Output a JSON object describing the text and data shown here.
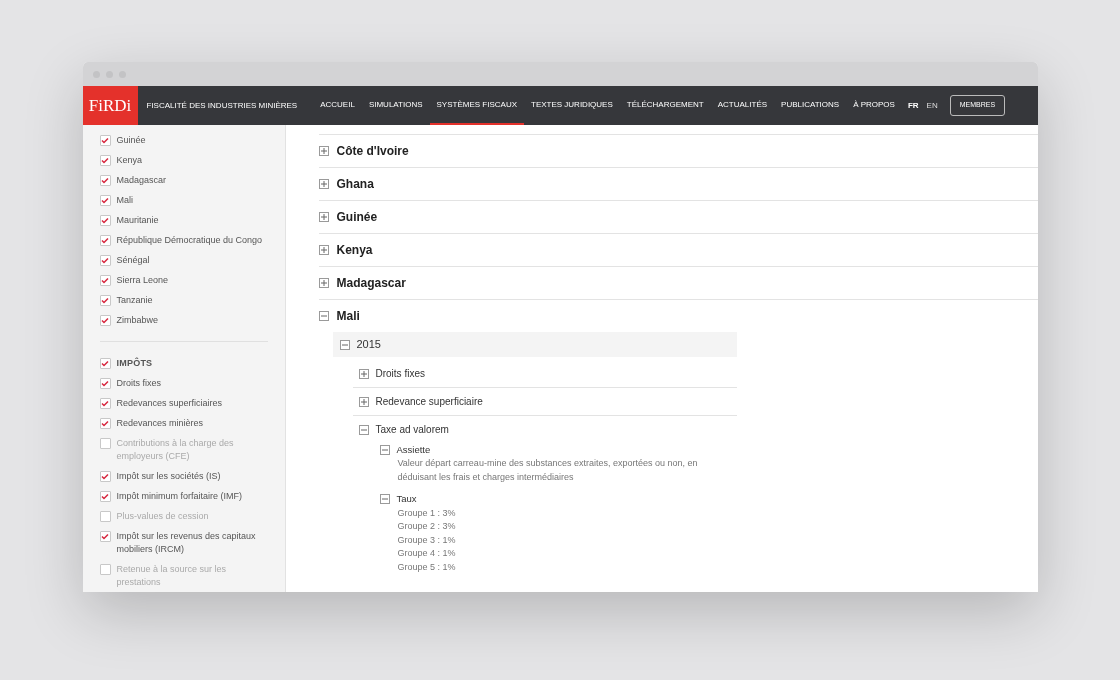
{
  "header": {
    "logo": "FiRDi",
    "site_title": "FISCALITÉ DES INDUSTRIES MINIÈRES",
    "nav": [
      {
        "label": "ACCUEIL",
        "selected": false
      },
      {
        "label": "SIMULATIONS",
        "selected": false
      },
      {
        "label": "SYSTÈMES FISCAUX",
        "selected": true
      },
      {
        "label": "TEXTES JURIDIQUES",
        "selected": false
      },
      {
        "label": "TÉLÉCHARGEMENT",
        "selected": false
      },
      {
        "label": "ACTUALITÉS",
        "selected": false
      },
      {
        "label": "PUBLICATIONS",
        "selected": false
      },
      {
        "label": "À PROPOS",
        "selected": false
      }
    ],
    "languages": [
      {
        "label": "FR",
        "selected": true
      },
      {
        "label": "EN",
        "selected": false
      }
    ],
    "members_button": "MEMBRES"
  },
  "sidebar": {
    "countries": [
      {
        "label": "Guinée",
        "checked": true
      },
      {
        "label": "Kenya",
        "checked": true
      },
      {
        "label": "Madagascar",
        "checked": true
      },
      {
        "label": "Mali",
        "checked": true
      },
      {
        "label": "Mauritanie",
        "checked": true
      },
      {
        "label": "République Démocratique du Congo",
        "checked": true
      },
      {
        "label": "Sénégal",
        "checked": true
      },
      {
        "label": "Sierra Leone",
        "checked": true
      },
      {
        "label": "Tanzanie",
        "checked": true
      },
      {
        "label": "Zimbabwe",
        "checked": true
      }
    ],
    "tax_group": {
      "label": "IMPÔTS",
      "checked": true
    },
    "taxes": [
      {
        "label": "Droits fixes",
        "checked": true
      },
      {
        "label": "Redevances superficiaires",
        "checked": true
      },
      {
        "label": "Redevances minières",
        "checked": true
      },
      {
        "label": "Contributions à la charge des employeurs (CFE)",
        "checked": false
      },
      {
        "label": "Impôt sur les sociétés (IS)",
        "checked": true
      },
      {
        "label": "Impôt minimum forfaitaire (IMF)",
        "checked": true
      },
      {
        "label": "Plus-values de cession",
        "checked": false
      },
      {
        "label": "Impôt sur les revenus des capitaux mobiliers (IRCM)",
        "checked": true
      },
      {
        "label": "Retenue à la source sur les prestations",
        "checked": false
      }
    ]
  },
  "countries": [
    {
      "name": "Côte d'Ivoire",
      "expanded": false
    },
    {
      "name": "Ghana",
      "expanded": false
    },
    {
      "name": "Guinée",
      "expanded": false
    },
    {
      "name": "Kenya",
      "expanded": false
    },
    {
      "name": "Madagascar",
      "expanded": false
    },
    {
      "name": "Mali",
      "expanded": true,
      "children": [
        {
          "name": "2015",
          "expanded": true,
          "children": [
            {
              "name": "Droits fixes",
              "expanded": false
            },
            {
              "name": "Redevance superficiaire",
              "expanded": false
            },
            {
              "name": "Taxe ad valorem",
              "expanded": true,
              "children": [
                {
                  "name": "Assiette",
                  "expanded": true,
                  "lines": [
                    "Valeur départ carreau-mine des substances extraites, exportées ou non, en déduisant les frais et charges intermédiaires"
                  ]
                },
                {
                  "name": "Taux",
                  "expanded": true,
                  "lines": [
                    "Groupe 1 : 3%",
                    "Groupe 2 : 3%",
                    "Groupe 3 : 1%",
                    "Groupe 4 : 1%",
                    "Groupe 5 : 1%"
                  ]
                }
              ]
            }
          ]
        }
      ]
    }
  ]
}
